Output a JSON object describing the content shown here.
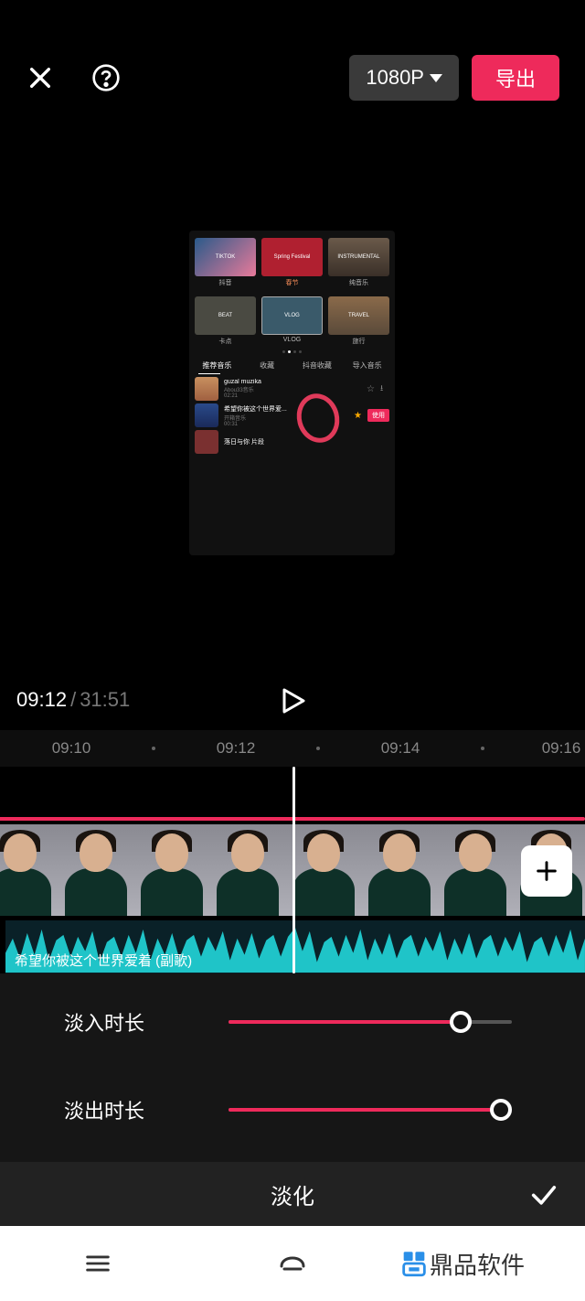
{
  "topbar": {
    "resolution": "1080P",
    "export": "导出"
  },
  "preview": {
    "row1": [
      "TIKTOK",
      "Spring Festival",
      "INSTRUMENTAL"
    ],
    "row1_labels": [
      "抖音",
      "春节",
      "纯音乐"
    ],
    "row2": [
      "BEAT",
      "VLOG",
      "TRAVEL"
    ],
    "row2_labels": [
      "卡点",
      "VLOG",
      "旅行"
    ],
    "tabs": [
      "推荐音乐",
      "收藏",
      "抖音收藏",
      "导入音乐"
    ],
    "list": [
      {
        "title": "guzal muzika",
        "sub": "Abou33音乐",
        "dur": "02:21"
      },
      {
        "title": "希望你被这个世界爱...",
        "sub": "开箱音乐",
        "dur": "00:31",
        "use": "使用"
      },
      {
        "title": "落日与你 片段",
        "sub": "",
        "dur": ""
      }
    ]
  },
  "playback": {
    "current": "09:12",
    "total": "31:51"
  },
  "ruler": {
    "t0": "09:10",
    "t1": "09:12",
    "t2": "09:14",
    "t3": "09:16"
  },
  "audio": {
    "label": "希望你被这个世界爱着 (副歌)"
  },
  "sliders": {
    "fade_in_label": "淡入时长",
    "fade_in_pct": 82,
    "fade_out_label": "淡出时长",
    "fade_out_pct": 96
  },
  "bottombar": {
    "title": "淡化"
  },
  "brand": {
    "text": "鼎品软件"
  }
}
